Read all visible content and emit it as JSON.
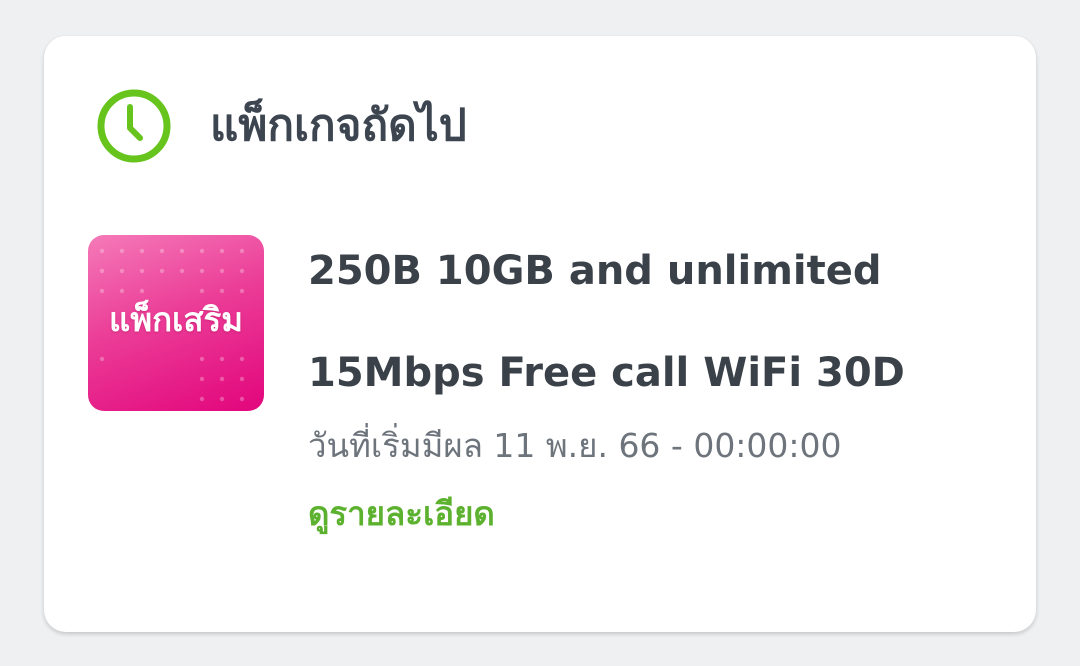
{
  "next_package": {
    "title": "แพ็กเกจถัดไป",
    "icon": "clock-icon",
    "package": {
      "badge_label": "แพ็กเสริม",
      "badge_colors": {
        "top": "#f57ab9",
        "bottom": "#e2057c"
      },
      "name_line1": "250B 10GB and unlimited",
      "name_line2": "15Mbps Free call WiFi 30D",
      "start_date": "วันที่เริ่มมีผล 11 พ.ย. 66 - 00:00:00",
      "details_link": "ดูรายละเอียด"
    }
  },
  "colors": {
    "accent_green": "#5cb12f",
    "clock_green": "#66c41c",
    "text_dark": "#3a4149",
    "text_muted": "#6d747c",
    "background": "#eef0f2",
    "card": "#ffffff"
  }
}
